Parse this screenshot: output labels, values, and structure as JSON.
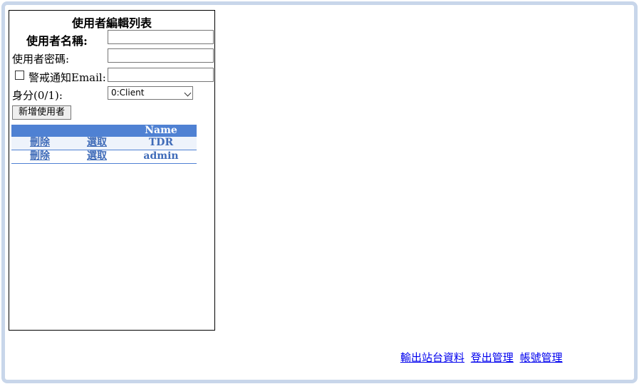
{
  "form": {
    "title": "使用者編輯列表",
    "username_label": "使用者名稱:",
    "password_label": "使用者密碼:",
    "alert_label": "警戒通知Email:",
    "role_label": "身分(0/1):",
    "role_selected": "0:Client",
    "username_value": "",
    "password_value": "",
    "email_value": "",
    "add_button": "新增使用者"
  },
  "table": {
    "headers": [
      "",
      "",
      "Name"
    ],
    "rows": [
      {
        "delete": "刪除",
        "select": "選取",
        "name": "TDR"
      },
      {
        "delete": "刪除",
        "select": "選取",
        "name": "admin"
      }
    ]
  },
  "footer": {
    "export": "輸出站台資料",
    "logout": "登出管理",
    "accounts": "帳號管理"
  },
  "colors": {
    "header_bg": "#4f81d3",
    "link": "#3f6bb8",
    "frame": "#c8d6ea"
  }
}
